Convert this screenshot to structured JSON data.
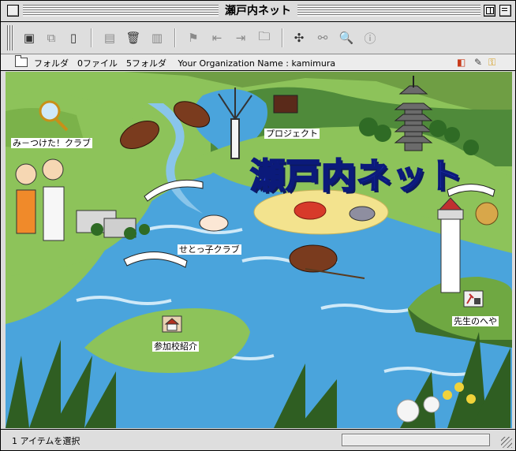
{
  "window": {
    "title": "瀬戸内ネット"
  },
  "toolbar": {
    "buttons": [
      {
        "name": "new-folder-icon",
        "glyph": "▣"
      },
      {
        "name": "duplicate-icon",
        "glyph": "⧉"
      },
      {
        "name": "new-file-icon",
        "glyph": "▯"
      },
      {
        "name": "list-view-icon",
        "glyph": "▤"
      },
      {
        "name": "trash-icon",
        "glyph": "🗑"
      },
      {
        "name": "info-icon",
        "glyph": "▥"
      },
      {
        "name": "arrow-flag-icon",
        "glyph": "⚑"
      },
      {
        "name": "move-left-icon",
        "glyph": "⇤"
      },
      {
        "name": "move-right-icon",
        "glyph": "⇥"
      },
      {
        "name": "folder-open-icon",
        "glyph": "🗀"
      },
      {
        "name": "network-icon",
        "glyph": "✣"
      },
      {
        "name": "link-icon",
        "glyph": "⚯"
      },
      {
        "name": "search-icon",
        "glyph": "🔍"
      },
      {
        "name": "user-info-icon",
        "glyph": "ⓘ"
      }
    ]
  },
  "infobar": {
    "path": "フォルダ　0ファイル　5フォルダ　 Your Organization Name : kamimura"
  },
  "content": {
    "logo": "瀬戸内ネット",
    "folders": {
      "mitsuketa": "み－つけた！クラブ",
      "project": "プロジェクト",
      "setokko": "せとっ子クラブ",
      "sankakou": "参加校紹介",
      "sensei": "先生のへや"
    }
  },
  "status": {
    "text": "1 アイテムを選択"
  },
  "colors": {
    "land": "#8dc35a",
    "sea": "#4aa4dc",
    "sea_light": "#a9d7f2",
    "logo": "#2a3fd8",
    "sand": "#f3e38e"
  }
}
